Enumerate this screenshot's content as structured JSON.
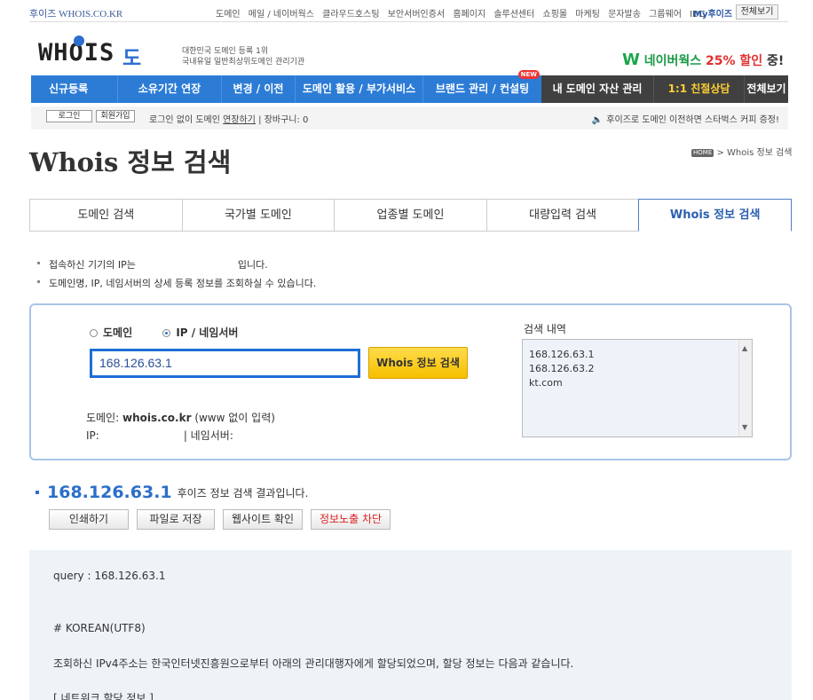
{
  "topbar": {
    "site": "후이즈 WHOIS.CO.KR",
    "links": [
      "도메인",
      "메일 / 네이버웍스",
      "클라우드호스팅",
      "보안서버인증서",
      "홈페이지",
      "솔루션센터",
      "쇼핑몰",
      "마케팅",
      "문자발송",
      "그룹웨어",
      "IDC"
    ],
    "my": "My후이즈",
    "all": "전체보기"
  },
  "logo": {
    "whois": "WHOIS",
    "domain": "도메인",
    "tag1": "대한민국 도메인 등록 1위",
    "tag2": "국내유일 일반최상위도메인 관리기관"
  },
  "promo": {
    "w": "W",
    "naverworks": "네이버웍스",
    "pct": "25% 할인",
    "tail": "중!"
  },
  "nav": {
    "blue": [
      "신규등록",
      "소유기간 연장",
      "변경 / 이전",
      "도메인 활용 / 부가서비스",
      "브랜드 관리 / 컨설팅"
    ],
    "new_badge": "NEW",
    "dark": [
      "내 도메인 자산 관리",
      "1:1 친절상담",
      "전체보기"
    ]
  },
  "loginrow": {
    "login": "로그인",
    "join": "회원가입",
    "msg_pre": "로그인 없이 도메인",
    "msg_link": "연장하기",
    "msg_post": "| 장바구니: 0",
    "right": "후이즈로 도메인 이전하면 스타벅스 커피 증정!"
  },
  "page": {
    "title": "Whois 정보 검색",
    "crumb_home": "HOME",
    "crumb": "> Whois 정보 검색"
  },
  "tabs": [
    "도메인 검색",
    "국가별 도메인",
    "업종별 도메인",
    "대량입력 검색",
    "Whois 정보 검색"
  ],
  "notices": {
    "n1_pre": "접속하신 기기의 IP는",
    "n1_post": "입니다.",
    "n2": "도메인명, IP, 네임서버의 상세 등록 정보를 조회하실 수 있습니다."
  },
  "search": {
    "radio_domain": "도메인",
    "radio_ip": "IP / 네임서버",
    "query": "168.126.63.1",
    "button": "Whois 정보 검색",
    "help1_pre": "도메인: ",
    "help1_example": "whois.co.kr",
    "help1_post": " (www 없이 입력)",
    "help2_ip": "IP:",
    "help2_ns": "| 네임서버:",
    "history_label": "검색 내역",
    "history": [
      "168.126.63.1",
      "168.126.63.2",
      "kt.com"
    ]
  },
  "result": {
    "ip": "168.126.63.1",
    "suffix": "후이즈 정보 검색 결과입니다.",
    "buttons": [
      "인쇄하기",
      "파일로 저장",
      "웹사이트 확인",
      "정보노출 차단"
    ],
    "lines": {
      "query": "query : 168.126.63.1",
      "korean": "# KOREAN(UTF8)",
      "desc": "조회하신 IPv4주소는 한국인터넷진흥원으로부터 아래의 관리대행자에게 할당되었으며, 할당 정보는 다음과 같습니다.",
      "section": "[ 네트워크 할당 정보 ]"
    }
  }
}
